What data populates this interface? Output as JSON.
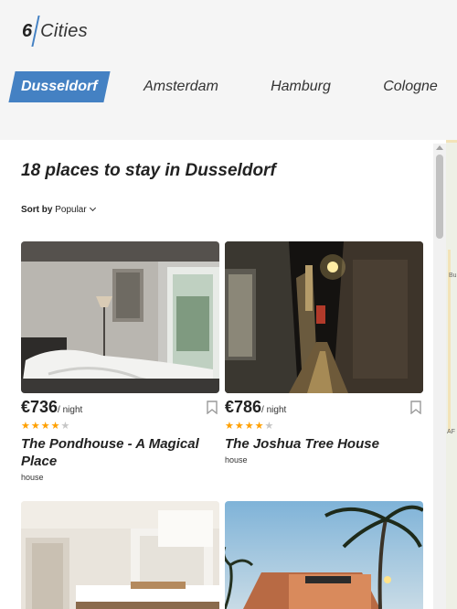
{
  "logo": {
    "number": "6",
    "word": "Cities"
  },
  "tabs": [
    {
      "label": "Dusseldorf",
      "active": true
    },
    {
      "label": "Amsterdam",
      "active": false
    },
    {
      "label": "Hamburg",
      "active": false
    },
    {
      "label": "Cologne",
      "active": false
    }
  ],
  "places_title": "18 places to stay in Dusseldorf",
  "sort": {
    "label": "Sort by",
    "value": "Popular"
  },
  "offers": [
    {
      "price": "€736",
      "per": "/ night",
      "rating": 4,
      "name": "The Pondhouse - A Magical Place",
      "type": "house"
    },
    {
      "price": "€786",
      "per": "/ night",
      "rating": 4,
      "name": "The Joshua Tree House",
      "type": "house"
    },
    {
      "name": "",
      "type": ""
    },
    {
      "name": "",
      "type": ""
    }
  ],
  "map": {
    "labels": [
      "Bu",
      "AF"
    ]
  },
  "colors": {
    "accent": "#4481c3",
    "star": "#ffa000",
    "star_off": "#c6c6c6"
  }
}
